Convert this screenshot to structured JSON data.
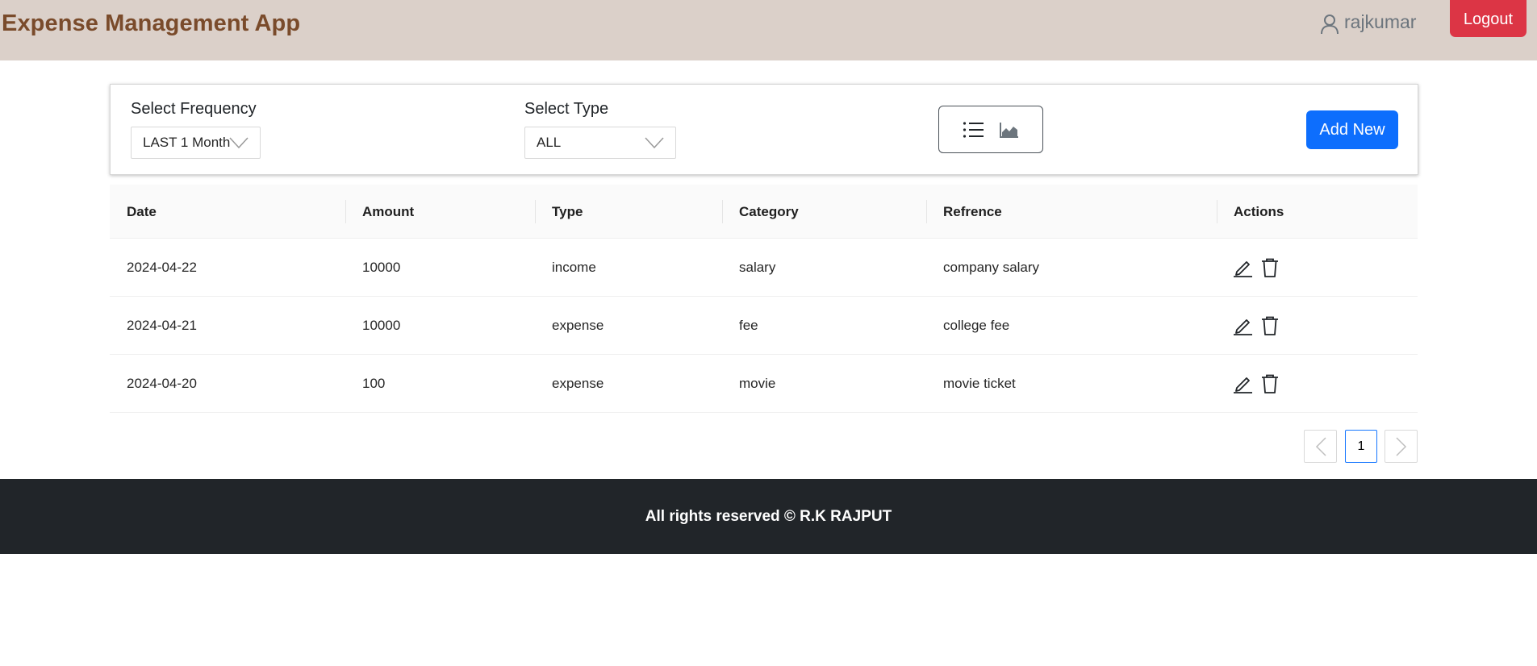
{
  "header": {
    "brand": "Expense Management App",
    "username": "rajkumar",
    "logout_label": "Logout"
  },
  "filters": {
    "frequency_label": "Select Frequency",
    "frequency_value": "LAST 1 Month",
    "type_label": "Select Type",
    "type_value": "ALL",
    "add_new_label": "Add New"
  },
  "table": {
    "columns": [
      "Date",
      "Amount",
      "Type",
      "Category",
      "Refrence",
      "Actions"
    ],
    "rows": [
      {
        "date": "2024-04-22",
        "amount": "10000",
        "type": "income",
        "category": "salary",
        "reference": "company salary"
      },
      {
        "date": "2024-04-21",
        "amount": "10000",
        "type": "expense",
        "category": "fee",
        "reference": "college fee"
      },
      {
        "date": "2024-04-20",
        "amount": "100",
        "type": "expense",
        "category": "movie",
        "reference": "movie ticket"
      }
    ]
  },
  "pagination": {
    "current_page": "1"
  },
  "footer": {
    "text": "All rights reserved © R.K RAJPUT"
  },
  "colors": {
    "navbar_bg": "#dbd0c9",
    "brand_text": "#7a4b2b",
    "logout_bg": "#dc3545",
    "primary": "#0d6efd",
    "footer_bg": "#212529"
  },
  "icons": [
    "user-icon",
    "list-view-icon",
    "chart-view-icon",
    "chevron-down-icon",
    "edit-icon",
    "delete-icon",
    "chevron-left-icon",
    "chevron-right-icon"
  ]
}
